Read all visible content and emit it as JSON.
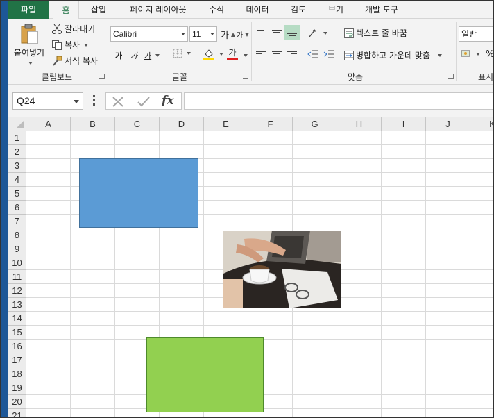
{
  "ribbon_tabs": [
    "파일",
    "홈",
    "삽입",
    "페이지 레이아웃",
    "수식",
    "데이터",
    "검토",
    "보기",
    "개발 도구"
  ],
  "active_tab": "홈",
  "clipboard": {
    "paste": "붙여넣기",
    "cut": "잘라내기",
    "copy": "복사",
    "format_painter": "서식 복사",
    "group_label": "클립보드"
  },
  "font": {
    "name": "Calibri",
    "size": "11",
    "grow": "가",
    "shrink": "가",
    "bold": "가",
    "italic": "가",
    "underline": "가",
    "font_color": "가",
    "group_label": "글꼴"
  },
  "alignment": {
    "wrap_text": "텍스트 줄 바꿈",
    "merge_center": "병합하고 가운데 맞춤",
    "group_label": "맞춤"
  },
  "number": {
    "format": "일반",
    "percent": "%",
    "group_label": "표시"
  },
  "formula_bar": {
    "name_box": "Q24",
    "fx": "fx",
    "formula": ""
  },
  "sheet": {
    "columns": [
      "A",
      "B",
      "C",
      "D",
      "E",
      "F",
      "G",
      "H",
      "I",
      "J",
      "K"
    ],
    "rows": [
      "1",
      "2",
      "3",
      "4",
      "5",
      "6",
      "7",
      "8",
      "9",
      "10",
      "11",
      "12",
      "13",
      "14",
      "15",
      "16",
      "17",
      "18",
      "19",
      "20",
      "21"
    ]
  },
  "shapes": [
    {
      "type": "rectangle",
      "fill": "#5b9bd5",
      "anchor": "B3:D7"
    },
    {
      "type": "picture",
      "subject": "coffee-cup-and-laptop",
      "anchor": "E8:G13"
    },
    {
      "type": "rectangle",
      "fill": "#92d050",
      "anchor": "C16:E20"
    }
  ],
  "colors": {
    "file_tab": "#217346",
    "accent": "#217346",
    "font_color_bar": "#e02020",
    "fill_color_bar": "#ffd900"
  }
}
